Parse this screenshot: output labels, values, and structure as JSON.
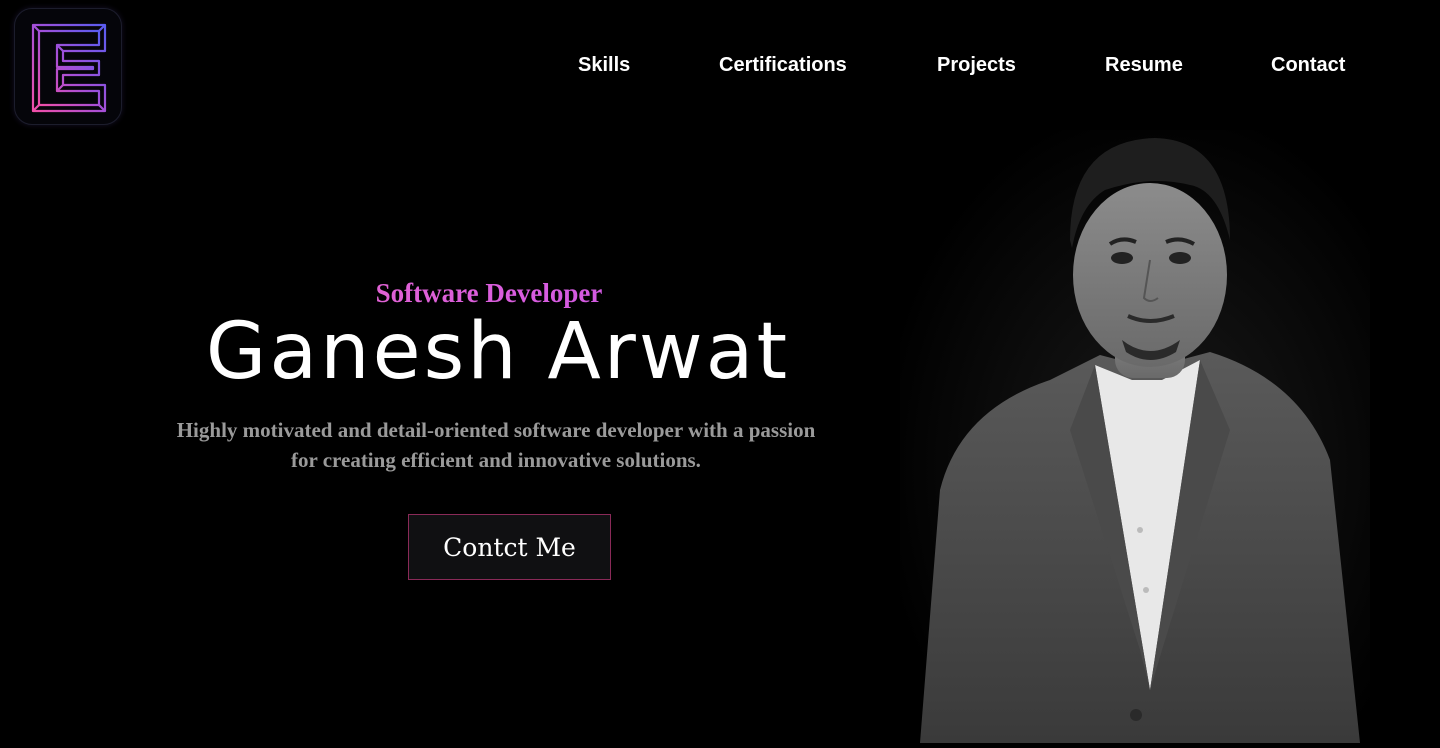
{
  "logo": {
    "icon": "monogram-logo-icon",
    "gradient_start": "#f24fa8",
    "gradient_end": "#6a5cf0"
  },
  "nav": {
    "items": [
      {
        "label": "Skills"
      },
      {
        "label": "Certifications"
      },
      {
        "label": "Projects"
      },
      {
        "label": "Resume"
      },
      {
        "label": "Contact"
      }
    ]
  },
  "hero": {
    "role": "Software Developer",
    "name": "Ganesh Arwat",
    "description_line1": "Highly motivated and detail-oriented software developer with a passion",
    "description_line2": "for creating efficient and innovative solutions.",
    "cta_label": "Contct Me"
  },
  "colors": {
    "background": "#000000",
    "accent_pink": "#f36fb8",
    "accent_purple": "#b04be6",
    "cta_border": "#8a2a58"
  }
}
